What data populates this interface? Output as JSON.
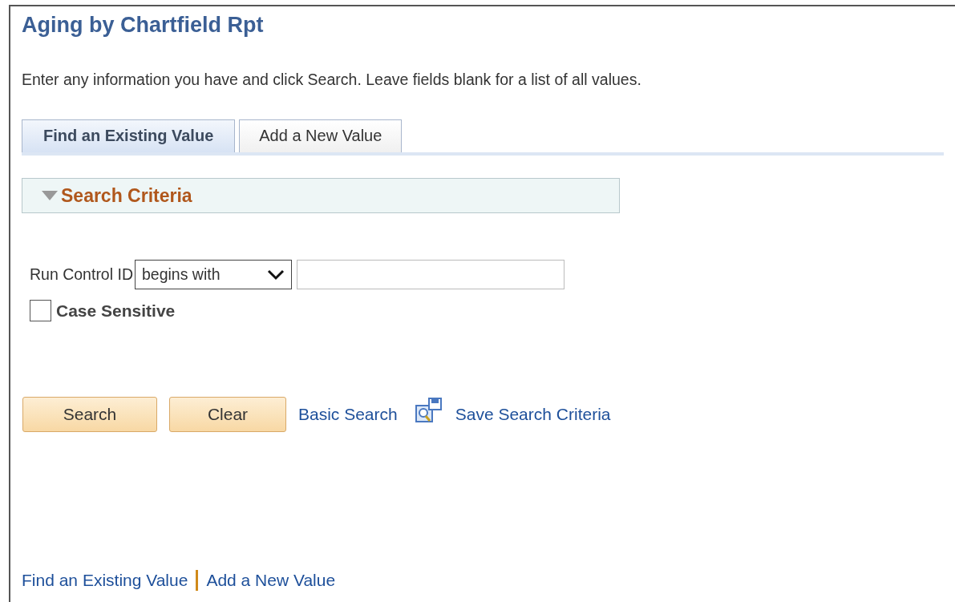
{
  "page": {
    "title": "Aging by Chartfield Rpt",
    "instructions": "Enter any information you have and click Search. Leave fields blank for a list of all values."
  },
  "tabs": [
    {
      "label": "Find an Existing Value",
      "selected": true
    },
    {
      "label": "Add a New Value",
      "selected": false
    }
  ],
  "section": {
    "title": "Search Criteria",
    "expanded": true
  },
  "criteria": {
    "label": "Run Control ID",
    "operator": "begins with"
  },
  "case_sensitive": {
    "label": "Case Sensitive",
    "checked": false
  },
  "buttons": [
    {
      "label": "Search"
    },
    {
      "label": "Clear"
    }
  ],
  "links": [
    {
      "label": "Basic Search"
    },
    {
      "label": "Save Search Criteria"
    }
  ],
  "footer_links": [
    {
      "label": "Find an Existing Value"
    },
    {
      "label": "Add a New Value"
    }
  ]
}
